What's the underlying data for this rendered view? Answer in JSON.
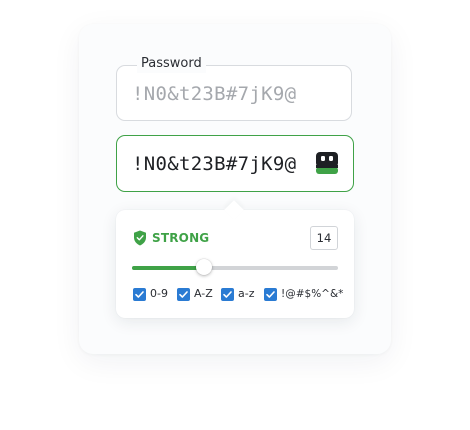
{
  "password_field": {
    "label": "Password",
    "placeholder": "!N0&t23B#7jK9@"
  },
  "generated_field": {
    "value": "!N0&t23B#7jK9@",
    "generate_icon": "robot-icon"
  },
  "strength": {
    "icon": "shield-icon",
    "label": "STRONG",
    "color": "#3fa247"
  },
  "length": {
    "value": "14",
    "slider_fraction": 0.35
  },
  "options": [
    {
      "label": "0-9",
      "checked": true
    },
    {
      "label": "A-Z",
      "checked": true
    },
    {
      "label": "a-z",
      "checked": true
    },
    {
      "label": "!@#$%^&*",
      "checked": true
    }
  ],
  "colors": {
    "accent": "#3fa247",
    "checkbox": "#2a7bd3"
  }
}
